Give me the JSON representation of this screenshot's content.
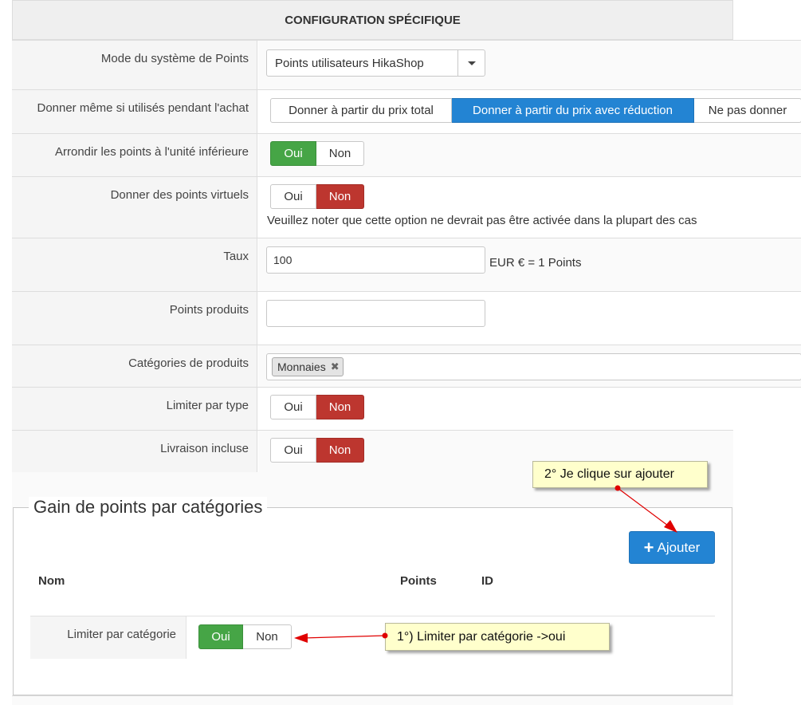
{
  "header": {
    "title": "CONFIGURATION SPÉCIFIQUE"
  },
  "rows": {
    "mode": {
      "label": "Mode du système de Points",
      "value": "Points utilisateurs HikaShop"
    },
    "give_used": {
      "label": "Donner même si utilisés pendant l'achat",
      "options": [
        "Donner à partir du prix total",
        "Donner à partir du prix avec réduction",
        "Ne pas donner"
      ],
      "selected": "Donner à partir du prix avec réduction"
    },
    "round": {
      "label": "Arrondir les points à l'unité inférieure",
      "yes": "Oui",
      "no": "Non",
      "selected": "Oui"
    },
    "virtual": {
      "label": "Donner des points virtuels",
      "yes": "Oui",
      "no": "Non",
      "selected": "Non",
      "note": "Veuillez noter que cette option ne devrait pas être activée dans la plupart des cas"
    },
    "rate": {
      "label": "Taux",
      "value": "100",
      "suffix": "EUR € = 1 Points"
    },
    "product_points": {
      "label": "Points produits",
      "value": ""
    },
    "categories": {
      "label": "Catégories de produits",
      "tag": "Monnaies"
    },
    "limit_type": {
      "label": "Limiter par type",
      "yes": "Oui",
      "no": "Non",
      "selected": "Non"
    },
    "shipping": {
      "label": "Livraison incluse",
      "yes": "Oui",
      "no": "Non",
      "selected": "Non"
    }
  },
  "section": {
    "legend": "Gain de points par catégories",
    "add_button": "Ajouter",
    "columns": [
      "Nom",
      "Points",
      "ID"
    ],
    "limit_category": {
      "label": "Limiter par catégorie",
      "yes": "Oui",
      "no": "Non",
      "selected": "Oui"
    }
  },
  "annotations": {
    "step1": "1°) Limiter par catégorie ->oui",
    "step2": "2° Je clique sur ajouter"
  },
  "colors": {
    "green": "#46a546",
    "red": "#bd362f",
    "blue": "#2384d3",
    "callout": "#ffffcc",
    "arrow": "#e00000"
  }
}
